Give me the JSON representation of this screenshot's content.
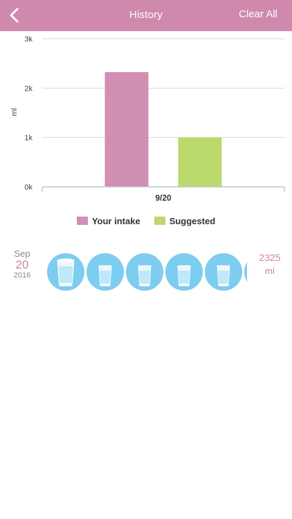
{
  "navbar": {
    "title": "History",
    "clear_label": "Clear All",
    "back_icon": "chevron-left-icon",
    "background_color": "#cf89ad"
  },
  "chart_data": {
    "type": "bar",
    "categories": [
      "9/20"
    ],
    "series": [
      {
        "name": "Your intake",
        "values": [
          2325
        ],
        "color": "#d08fb3"
      },
      {
        "name": "Suggested",
        "values": [
          1000
        ],
        "color": "#bcd96d"
      }
    ],
    "ylabel": "ml",
    "ylim": [
      0,
      3000
    ],
    "yticks": [
      0,
      1000,
      2000,
      3000
    ],
    "ytick_labels": [
      "0k",
      "1k",
      "2k",
      "3k"
    ],
    "grid": true,
    "legend_position": "bottom-center"
  },
  "legend": {
    "intake_label": "Your intake",
    "suggested_label": "Suggested"
  },
  "history": {
    "month": "Sep",
    "day": "20",
    "year": "2016",
    "total_value": "2325",
    "total_unit": "ml",
    "glass_icon": "water-glass-icon"
  }
}
